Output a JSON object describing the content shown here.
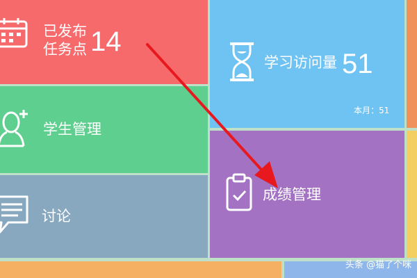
{
  "colors": {
    "published_tile": "#f76a6b",
    "visits_tile": "#6fc3f3",
    "students_tile": "#5fcf8f",
    "grades_tile": "#a372c2",
    "discussion_tile": "#88a8c0",
    "edge_orange": "#f0905a",
    "edge_yellow": "#f3cf61",
    "bottom_orange": "#f5b063",
    "bottom_blue": "#8fb6ea",
    "arrow": "#e8191e"
  },
  "tiles": {
    "published": {
      "label_line1": "已发布",
      "label_line2": "任务点",
      "count": "14",
      "icon": "calendar-icon"
    },
    "visits": {
      "label": "学习访问量",
      "count": "51",
      "monthly": "本月：51",
      "icon": "hourglass-icon"
    },
    "students": {
      "label": "学生管理",
      "icon": "add-user-icon"
    },
    "grades": {
      "label": "成绩管理",
      "icon": "clipboard-check-icon"
    },
    "discussion": {
      "label": "讨论",
      "icon": "chat-icon"
    }
  },
  "watermark": "头条 @猫了个咪"
}
